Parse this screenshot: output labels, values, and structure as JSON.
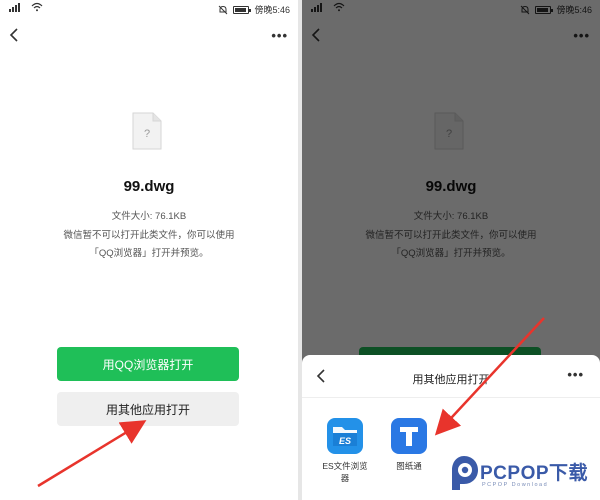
{
  "status_bar": {
    "time": "傍晚5:46"
  },
  "file": {
    "name": "99.dwg",
    "size_label": "文件大小: 76.1KB",
    "notice_line1": "微信暂不可以打开此类文件，你可以使用",
    "notice_line2": "「QQ浏览器」打开并预览。"
  },
  "left_screen": {
    "primary_button": "用QQ浏览器打开",
    "secondary_button": "用其他应用打开"
  },
  "right_screen": {
    "sheet_title": "用其他应用打开",
    "apps": [
      {
        "label_line1": "ES文件浏览",
        "label_line2": "器",
        "icon": "es-file-explorer-icon"
      },
      {
        "label_line1": "图纸通",
        "icon": "tuzhitong-icon"
      }
    ]
  },
  "watermark": {
    "brand": "PCPOP下载",
    "tagline": "PCPOP Download"
  },
  "colors": {
    "primary_green": "#1fbf58",
    "arrow_red": "#e8342c",
    "app_blue": "#2a78e4"
  }
}
